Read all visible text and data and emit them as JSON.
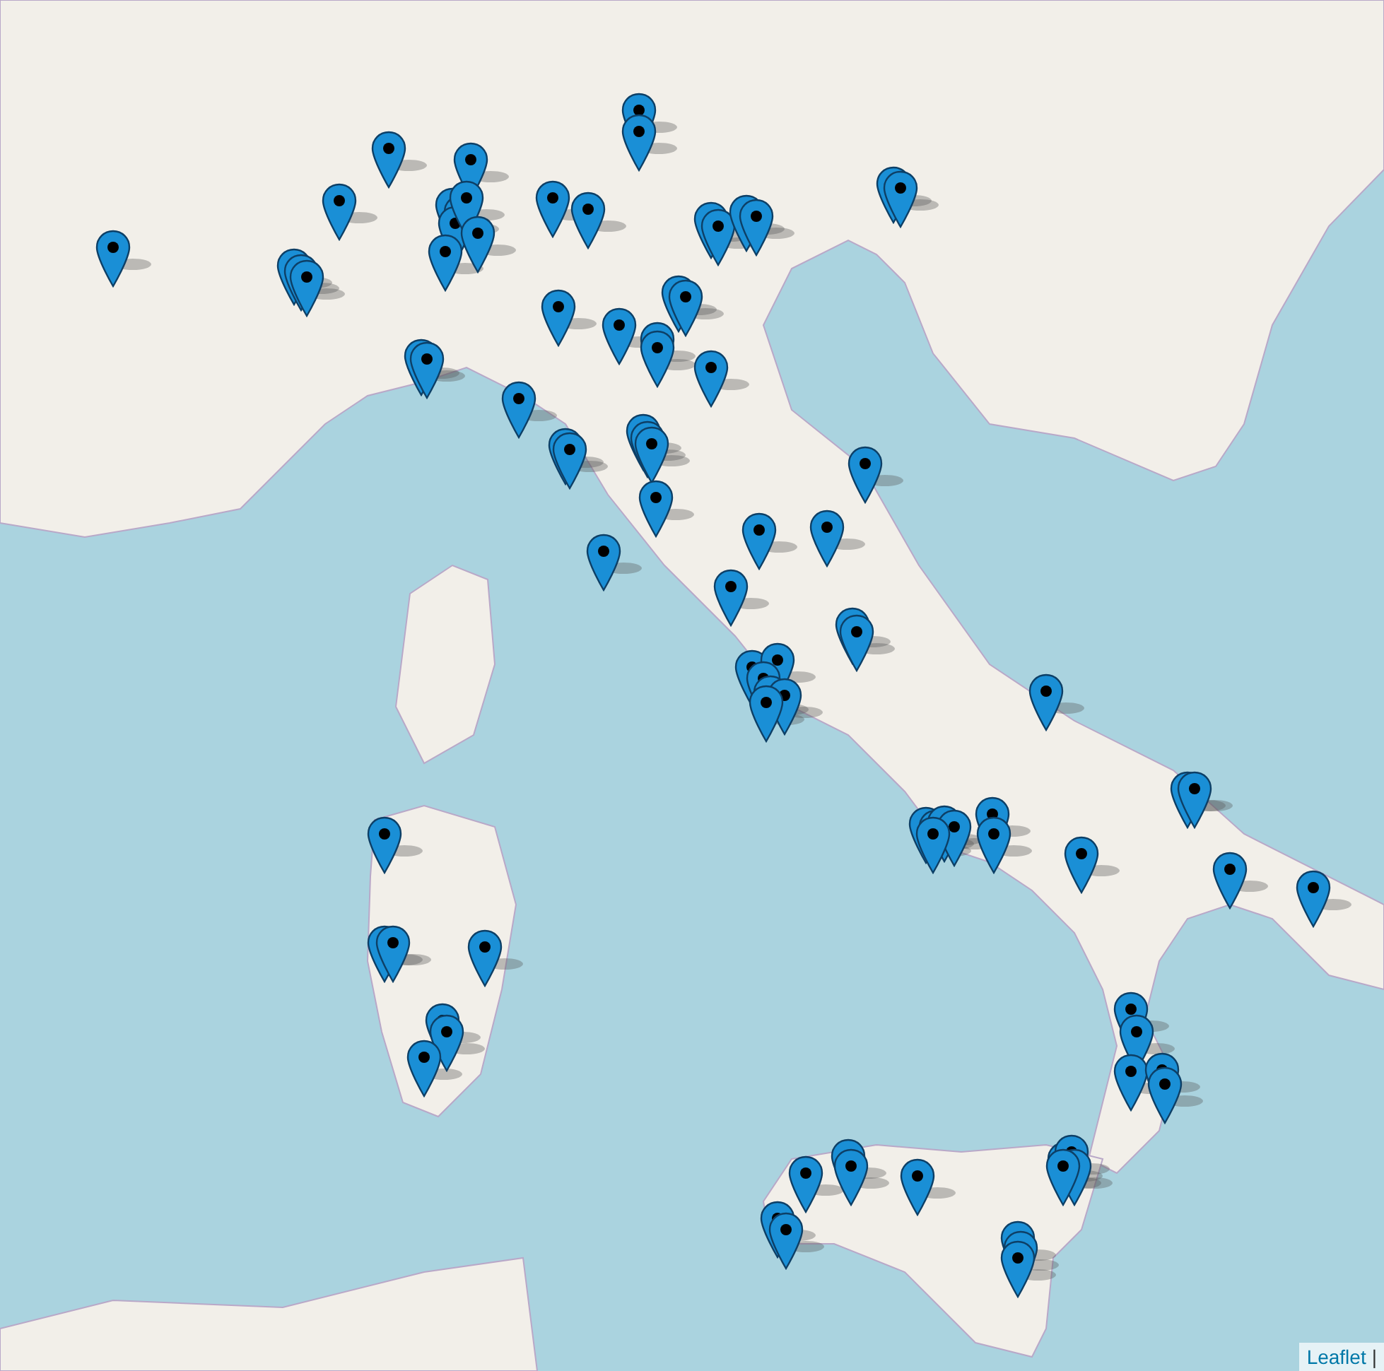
{
  "attribution": {
    "link": "Leaflet",
    "separator": "|"
  }
}
